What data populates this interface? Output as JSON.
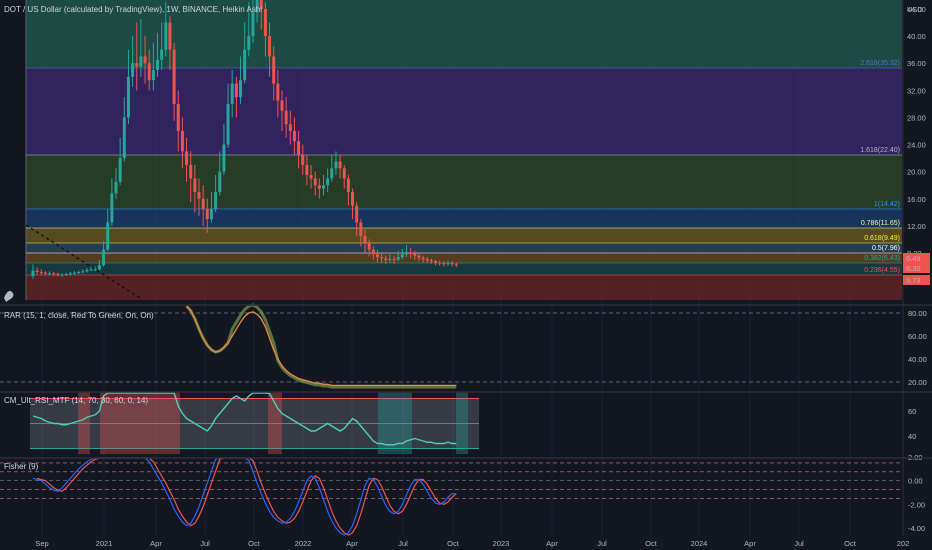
{
  "header": {
    "title": "DOT / US Dollar (calculated by TradingView), 1W, BINANCE, Heikin Ashi",
    "currency": "USD"
  },
  "colors": {
    "background": "#131722",
    "bull": "#26a69a",
    "bear": "#ef5350",
    "fib_line": "#787b86"
  },
  "chart_data": [
    {
      "type": "candlestick",
      "title": "DOT / US Dollar (calculated by TradingView), 1W, BINANCE, Heikin Ashi",
      "x_ticks": [
        "Sep",
        "2021",
        "Apr",
        "Jul",
        "Oct",
        "2022",
        "Apr",
        "Jul",
        "Oct",
        "2023",
        "Apr",
        "Jul",
        "Oct",
        "2024",
        "Apr",
        "Jul",
        "Oct",
        "202"
      ],
      "y_ticks": [
        "44.00",
        "40.00",
        "36.00",
        "32.00",
        "28.00",
        "24.00",
        "20.00",
        "16.00",
        "12.00",
        "8.00"
      ],
      "last_price_labels": [
        "6.49",
        "6.30",
        "5.73"
      ],
      "fib_levels": [
        {
          "label": "2.618(35.32)",
          "value": 35.32,
          "color": "#5d6bd6"
        },
        {
          "label": "1.618(22.40)",
          "value": 22.4,
          "color": "#b2b5be"
        },
        {
          "label": "1(14.42)",
          "value": 14.42,
          "color": "#2196f3"
        },
        {
          "label": "0.786(11.65)",
          "value": 11.65,
          "color": "#fff59d"
        },
        {
          "label": "0.618(9.49)",
          "value": 9.49,
          "color": "#ffeb3b"
        },
        {
          "label": "0.5(7.96)",
          "value": 7.96,
          "color": "#ffffff"
        },
        {
          "label": "0.382(6.43)",
          "value": 6.43,
          "color": "#26a69a"
        },
        {
          "label": "0.236(4.55)",
          "value": 4.55,
          "color": "#ef5350"
        }
      ],
      "candles": [
        {
          "o": 4.6,
          "c": 5.4,
          "h": 6.3,
          "l": 4.2
        },
        {
          "o": 5.4,
          "c": 5.2,
          "h": 5.9,
          "l": 4.8
        },
        {
          "o": 5.2,
          "c": 5.1,
          "h": 5.6,
          "l": 4.7
        },
        {
          "o": 5.1,
          "c": 5.0,
          "h": 5.3,
          "l": 4.7
        },
        {
          "o": 5.0,
          "c": 5.0,
          "h": 5.3,
          "l": 4.7
        },
        {
          "o": 5.0,
          "c": 4.9,
          "h": 5.2,
          "l": 4.6
        },
        {
          "o": 4.9,
          "c": 4.8,
          "h": 5.1,
          "l": 4.5
        },
        {
          "o": 4.8,
          "c": 4.8,
          "h": 5.0,
          "l": 4.5
        },
        {
          "o": 4.8,
          "c": 4.9,
          "h": 5.1,
          "l": 4.6
        },
        {
          "o": 4.9,
          "c": 5.0,
          "h": 5.2,
          "l": 4.7
        },
        {
          "o": 5.0,
          "c": 5.1,
          "h": 5.3,
          "l": 4.8
        },
        {
          "o": 5.1,
          "c": 5.2,
          "h": 5.4,
          "l": 4.9
        },
        {
          "o": 5.2,
          "c": 5.3,
          "h": 5.6,
          "l": 5.0
        },
        {
          "o": 5.3,
          "c": 5.5,
          "h": 5.8,
          "l": 5.1
        },
        {
          "o": 5.5,
          "c": 5.6,
          "h": 6.0,
          "l": 5.3
        },
        {
          "o": 5.6,
          "c": 5.6,
          "h": 6.0,
          "l": 5.3
        },
        {
          "o": 5.6,
          "c": 6.2,
          "h": 7.0,
          "l": 5.4
        },
        {
          "o": 6.2,
          "c": 8.5,
          "h": 9.8,
          "l": 6.0
        },
        {
          "o": 8.5,
          "c": 12.5,
          "h": 14.5,
          "l": 8.3
        },
        {
          "o": 12.5,
          "c": 16.8,
          "h": 19.0,
          "l": 12.0
        },
        {
          "o": 16.8,
          "c": 18.5,
          "h": 20.5,
          "l": 16.0
        },
        {
          "o": 18.5,
          "c": 22.0,
          "h": 25.0,
          "l": 18.0
        },
        {
          "o": 22.0,
          "c": 28.0,
          "h": 31.0,
          "l": 21.5
        },
        {
          "o": 28.0,
          "c": 34.0,
          "h": 38.0,
          "l": 27.0
        },
        {
          "o": 34.0,
          "c": 36.0,
          "h": 40.0,
          "l": 32.5
        },
        {
          "o": 36.0,
          "c": 35.5,
          "h": 42.0,
          "l": 32.0
        },
        {
          "o": 35.5,
          "c": 37.0,
          "h": 42.5,
          "l": 34.0
        },
        {
          "o": 37.0,
          "c": 36.0,
          "h": 40.0,
          "l": 33.0
        },
        {
          "o": 36.0,
          "c": 33.5,
          "h": 38.0,
          "l": 32.0
        },
        {
          "o": 33.5,
          "c": 35.0,
          "h": 39.0,
          "l": 32.0
        },
        {
          "o": 35.0,
          "c": 36.5,
          "h": 40.5,
          "l": 34.0
        },
        {
          "o": 36.5,
          "c": 38.0,
          "h": 42.0,
          "l": 35.0
        },
        {
          "o": 38.0,
          "c": 42.0,
          "h": 45.0,
          "l": 37.0
        },
        {
          "o": 42.0,
          "c": 38.0,
          "h": 43.0,
          "l": 35.0
        },
        {
          "o": 38.0,
          "c": 30.0,
          "h": 39.0,
          "l": 27.5
        },
        {
          "o": 30.0,
          "c": 26.0,
          "h": 32.0,
          "l": 23.0
        },
        {
          "o": 26.0,
          "c": 23.0,
          "h": 28.0,
          "l": 20.5
        },
        {
          "o": 23.0,
          "c": 21.0,
          "h": 25.0,
          "l": 18.5
        },
        {
          "o": 21.0,
          "c": 19.0,
          "h": 23.0,
          "l": 15.5
        },
        {
          "o": 19.0,
          "c": 17.0,
          "h": 21.0,
          "l": 14.0
        },
        {
          "o": 17.0,
          "c": 16.0,
          "h": 19.0,
          "l": 13.5
        },
        {
          "o": 16.0,
          "c": 14.5,
          "h": 18.0,
          "l": 12.0
        },
        {
          "o": 14.5,
          "c": 13.0,
          "h": 16.0,
          "l": 11.0
        },
        {
          "o": 13.0,
          "c": 14.5,
          "h": 17.0,
          "l": 12.5
        },
        {
          "o": 14.5,
          "c": 17.0,
          "h": 19.5,
          "l": 14.0
        },
        {
          "o": 17.0,
          "c": 20.0,
          "h": 23.0,
          "l": 16.5
        },
        {
          "o": 20.0,
          "c": 24.0,
          "h": 27.0,
          "l": 19.5
        },
        {
          "o": 24.0,
          "c": 30.0,
          "h": 33.0,
          "l": 23.5
        },
        {
          "o": 30.0,
          "c": 33.0,
          "h": 35.0,
          "l": 28.0
        },
        {
          "o": 33.0,
          "c": 31.0,
          "h": 34.0,
          "l": 28.0
        },
        {
          "o": 31.0,
          "c": 33.5,
          "h": 37.0,
          "l": 30.0
        },
        {
          "o": 33.5,
          "c": 38.0,
          "h": 42.0,
          "l": 33.0
        },
        {
          "o": 38.0,
          "c": 40.0,
          "h": 45.0,
          "l": 37.0
        },
        {
          "o": 40.0,
          "c": 43.5,
          "h": 47.0,
          "l": 39.0
        },
        {
          "o": 43.5,
          "c": 45.5,
          "h": 49.0,
          "l": 42.0
        },
        {
          "o": 45.5,
          "c": 44.0,
          "h": 48.0,
          "l": 41.0
        },
        {
          "o": 44.0,
          "c": 40.0,
          "h": 45.0,
          "l": 37.0
        },
        {
          "o": 40.0,
          "c": 37.0,
          "h": 42.0,
          "l": 34.0
        },
        {
          "o": 37.0,
          "c": 33.0,
          "h": 38.5,
          "l": 30.5
        },
        {
          "o": 33.0,
          "c": 30.5,
          "h": 35.0,
          "l": 28.0
        },
        {
          "o": 30.5,
          "c": 29.0,
          "h": 32.0,
          "l": 26.0
        },
        {
          "o": 29.0,
          "c": 27.0,
          "h": 31.0,
          "l": 25.0
        },
        {
          "o": 27.0,
          "c": 26.0,
          "h": 29.0,
          "l": 24.0
        },
        {
          "o": 26.0,
          "c": 24.5,
          "h": 28.0,
          "l": 22.5
        },
        {
          "o": 24.5,
          "c": 22.5,
          "h": 26.0,
          "l": 20.5
        },
        {
          "o": 22.5,
          "c": 21.0,
          "h": 24.0,
          "l": 19.5
        },
        {
          "o": 21.0,
          "c": 19.5,
          "h": 22.5,
          "l": 18.0
        },
        {
          "o": 19.5,
          "c": 19.0,
          "h": 21.0,
          "l": 17.5
        },
        {
          "o": 19.0,
          "c": 18.0,
          "h": 20.0,
          "l": 16.5
        },
        {
          "o": 18.0,
          "c": 17.5,
          "h": 19.0,
          "l": 16.0
        },
        {
          "o": 17.5,
          "c": 18.0,
          "h": 19.5,
          "l": 16.5
        },
        {
          "o": 18.0,
          "c": 19.0,
          "h": 20.5,
          "l": 17.0
        },
        {
          "o": 19.0,
          "c": 20.5,
          "h": 22.5,
          "l": 18.5
        },
        {
          "o": 20.5,
          "c": 21.5,
          "h": 23.0,
          "l": 19.5
        },
        {
          "o": 21.5,
          "c": 20.5,
          "h": 22.5,
          "l": 19.0
        },
        {
          "o": 20.5,
          "c": 19.0,
          "h": 21.0,
          "l": 17.5
        },
        {
          "o": 19.0,
          "c": 17.0,
          "h": 19.5,
          "l": 15.0
        },
        {
          "o": 17.0,
          "c": 15.0,
          "h": 17.5,
          "l": 13.0
        },
        {
          "o": 15.0,
          "c": 12.5,
          "h": 15.5,
          "l": 10.5
        },
        {
          "o": 12.5,
          "c": 10.5,
          "h": 13.0,
          "l": 9.0
        },
        {
          "o": 10.5,
          "c": 9.5,
          "h": 11.5,
          "l": 8.0
        },
        {
          "o": 9.5,
          "c": 8.5,
          "h": 10.0,
          "l": 7.5
        },
        {
          "o": 8.5,
          "c": 7.8,
          "h": 9.0,
          "l": 7.0
        },
        {
          "o": 7.8,
          "c": 7.4,
          "h": 8.5,
          "l": 6.6
        },
        {
          "o": 7.4,
          "c": 7.2,
          "h": 8.0,
          "l": 6.5
        },
        {
          "o": 7.2,
          "c": 7.0,
          "h": 7.6,
          "l": 6.4
        },
        {
          "o": 7.0,
          "c": 7.1,
          "h": 7.8,
          "l": 6.5
        },
        {
          "o": 7.1,
          "c": 7.0,
          "h": 7.6,
          "l": 6.4
        },
        {
          "o": 7.0,
          "c": 7.4,
          "h": 8.3,
          "l": 6.8
        },
        {
          "o": 7.4,
          "c": 7.8,
          "h": 8.6,
          "l": 7.1
        },
        {
          "o": 7.8,
          "c": 8.0,
          "h": 9.2,
          "l": 7.4
        },
        {
          "o": 8.0,
          "c": 7.9,
          "h": 8.8,
          "l": 7.2
        },
        {
          "o": 7.9,
          "c": 7.6,
          "h": 8.3,
          "l": 7.0
        },
        {
          "o": 7.6,
          "c": 7.3,
          "h": 7.9,
          "l": 6.8
        },
        {
          "o": 7.3,
          "c": 7.1,
          "h": 7.6,
          "l": 6.6
        },
        {
          "o": 7.1,
          "c": 6.9,
          "h": 7.4,
          "l": 6.5
        },
        {
          "o": 6.9,
          "c": 6.8,
          "h": 7.2,
          "l": 6.4
        },
        {
          "o": 6.8,
          "c": 6.6,
          "h": 7.0,
          "l": 6.2
        },
        {
          "o": 6.6,
          "c": 6.5,
          "h": 6.9,
          "l": 6.1
        },
        {
          "o": 6.5,
          "c": 6.4,
          "h": 6.8,
          "l": 6.0
        },
        {
          "o": 6.4,
          "c": 6.5,
          "h": 6.9,
          "l": 6.1
        },
        {
          "o": 6.5,
          "c": 6.4,
          "h": 6.8,
          "l": 6.0
        },
        {
          "o": 6.4,
          "c": 6.3,
          "h": 6.6,
          "l": 5.9
        }
      ]
    },
    {
      "type": "line",
      "title": "RAR (15, 1, close, Red To Green, On, On)",
      "y_ticks": [
        "80.00",
        "60.00",
        "40.00",
        "20.00"
      ],
      "x_start_week": 37,
      "series": [
        {
          "values": [
            86,
            82,
            75,
            66,
            58,
            52,
            48,
            46,
            47,
            50,
            54,
            60,
            66,
            72,
            77,
            80,
            81,
            79,
            75,
            68,
            58,
            48,
            40,
            34,
            30,
            27,
            25,
            23,
            22,
            21,
            20,
            19,
            19,
            18,
            18,
            17,
            17,
            17,
            17,
            17,
            17,
            17,
            17,
            17,
            17,
            17,
            17,
            17,
            17,
            17,
            17,
            17,
            17,
            17,
            17,
            17,
            17,
            17,
            17,
            17,
            17,
            17,
            17,
            17,
            17,
            17
          ]
        }
      ]
    },
    {
      "type": "line",
      "title": "CM_Ult_RSI_MTF (14, 70, 30, 60, 0, 14)",
      "y_ticks": [
        "60",
        "40"
      ],
      "x_start_week": 0,
      "series": [
        {
          "values": [
            56,
            55,
            54,
            52,
            51,
            50,
            50,
            49,
            49,
            50,
            51,
            52,
            53,
            55,
            56,
            57,
            60,
            72,
            82,
            86,
            84,
            86,
            88,
            88,
            85,
            82,
            83,
            84,
            80,
            78,
            80,
            82,
            84,
            86,
            76,
            64,
            58,
            54,
            52,
            50,
            48,
            46,
            44,
            48,
            54,
            58,
            62,
            66,
            70,
            72,
            70,
            68,
            72,
            76,
            80,
            82,
            80,
            74,
            68,
            62,
            58,
            56,
            54,
            52,
            50,
            48,
            46,
            44,
            44,
            46,
            48,
            50,
            48,
            46,
            44,
            46,
            50,
            54,
            52,
            48,
            44,
            40,
            36,
            34,
            34,
            33,
            33,
            33,
            34,
            34,
            36,
            37,
            38,
            37,
            36,
            35,
            35,
            34,
            34,
            34,
            35,
            34,
            34
          ]
        }
      ]
    },
    {
      "type": "line",
      "title": "Fisher (9)",
      "y_ticks": [
        "2.00",
        "0.00",
        "-2.00",
        "-4.00"
      ],
      "x_start_week": 0,
      "series": [
        {
          "values": [
            0.2,
            0.1,
            0.0,
            -0.3,
            -0.6,
            -0.8,
            -0.9,
            -0.6,
            -0.2,
            0.2,
            0.6,
            1.0,
            1.3,
            1.6,
            1.8,
            2.1,
            2.4,
            2.8,
            3.2,
            3.6,
            3.8,
            4.0,
            3.9,
            3.7,
            3.4,
            3.0,
            2.6,
            2.2,
            1.6,
            1.0,
            0.4,
            -0.2,
            -0.9,
            -1.6,
            -2.4,
            -3.0,
            -3.5,
            -3.8,
            -3.6,
            -3.0,
            -2.2,
            -1.2,
            -0.2,
            0.8,
            1.8,
            2.6,
            3.2,
            3.6,
            3.8,
            3.7,
            3.3,
            2.6,
            1.7,
            0.8,
            -0.2,
            -1.1,
            -1.9,
            -2.6,
            -3.1,
            -3.4,
            -3.6,
            -3.5,
            -3.2,
            -2.6,
            -1.8,
            -0.9,
            0.0,
            0.4,
            0.2,
            -0.6,
            -1.6,
            -2.6,
            -3.4,
            -4.0,
            -4.4,
            -4.6,
            -4.4,
            -3.8,
            -2.8,
            -1.6,
            -0.4,
            0.2,
            0.1,
            -0.5,
            -1.3,
            -2.1,
            -2.6,
            -2.8,
            -2.6,
            -2.0,
            -1.2,
            -0.4,
            0.1,
            0.1,
            -0.3,
            -0.9,
            -1.5,
            -1.9,
            -2.0,
            -1.8,
            -1.4,
            -1.1,
            -1.1
          ]
        }
      ]
    }
  ]
}
